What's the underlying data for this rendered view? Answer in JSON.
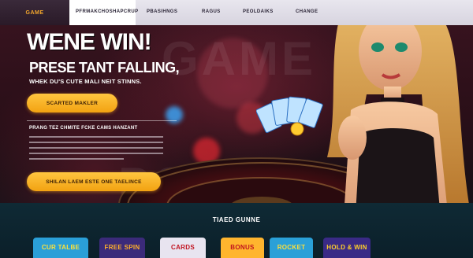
{
  "nav": {
    "brand": "GAME",
    "items": [
      "PFRMAKCHOSHAPCRUP",
      "PBASIHNGS",
      "RAGUS",
      "PEOLDAIKS",
      "CHANGE"
    ]
  },
  "hero": {
    "headline": "WENE WIN!",
    "subhead": "PRESE TANT FALLING,",
    "tagline": "WHEK DU'S CUTE MALI NEIT STINNS.",
    "cta_primary": "SCARTED MAKLER",
    "info_title": "PRANG TEZ CHMITE FCKE CAMS HANZANT",
    "cta_secondary": "SHILAN LAEM ESTE ONE TAELINCE"
  },
  "watermark": [
    "GAME",
    "PCGAME"
  ],
  "games": {
    "title": "TIAED GUNNE",
    "tiles": [
      {
        "label": "CUR TALBE",
        "color": "#2a9fd8",
        "text_color": "#ffe23a"
      },
      {
        "label": "FREE SPIN",
        "color": "#3b2a7a",
        "text_color": "#ffb02a"
      },
      {
        "label": "CARDS",
        "color": "#e8e4f0",
        "text_color": "#c1121f"
      },
      {
        "label": "BONUS",
        "color": "#ffb52e",
        "text_color": "#c1121f"
      },
      {
        "label": "ROCKET",
        "color": "#2aa0d8",
        "text_color": "#ffdf3a"
      },
      {
        "label": "HOLD & WIN",
        "color": "#3a2a86",
        "text_color": "#ffcf2a"
      }
    ]
  },
  "colors": {
    "accent": "#f5a623",
    "nav_bg": "#e3e1ea",
    "bar_bg": "#0f2a35"
  }
}
